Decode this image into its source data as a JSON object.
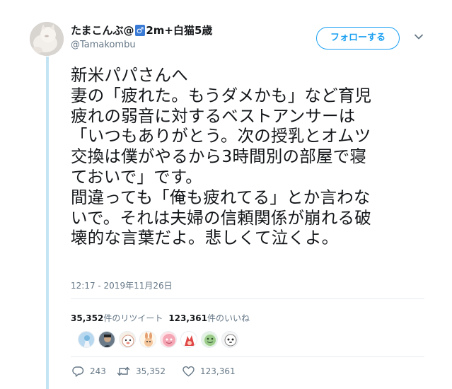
{
  "author": {
    "name_prefix": "たまこんぶ@",
    "name_badge": "♂",
    "name_suffix": "2m+白猫5歳",
    "handle": "@Tamakombu"
  },
  "follow_label": "フォローする",
  "tweet_text": "新米パパさんへ\n妻の「疲れた。もうダメかも」など育児\n疲れの弱音に対するベストアンサーは\n「いつもありがとう。次の授乳とオムツ\n交換は僕がやるから3時間別の部屋で寝\nておいで」です。\n間違っても「俺も疲れてる」とか言わな\nいで。それは夫婦の信頼関係が崩れる破\n壊的な言葉だよ。悲しくて泣くよ。",
  "timestamp": "12:17 - 2019年11月26日",
  "stats": {
    "retweet_count": "35,352",
    "retweet_label": "件のリツイート",
    "like_count": "123,361",
    "like_label": "件のいいね"
  },
  "actions": {
    "reply_count": "243",
    "retweet_count": "35,352",
    "like_count": "123,361"
  },
  "icons": {
    "follow_color": "#1da1f2",
    "muted_color": "#657786",
    "caret": "chevron-down-icon",
    "reply": "reply-icon",
    "retweet": "retweet-icon",
    "like": "heart-icon"
  }
}
